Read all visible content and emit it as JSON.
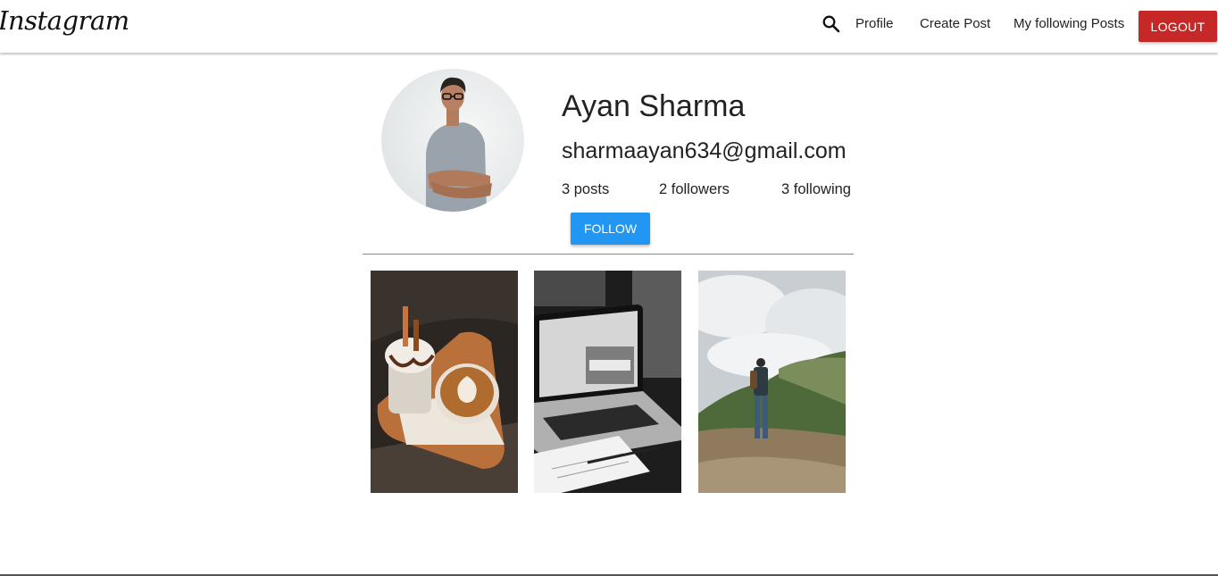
{
  "nav": {
    "brand": "Instagram",
    "search_icon": "search-icon",
    "links": [
      "Profile",
      "Create Post",
      "My following Posts"
    ],
    "logout_label": "LOGOUT"
  },
  "profile": {
    "name": "Ayan Sharma",
    "email": "sharmaayan634@gmail.com",
    "posts": "3 posts",
    "followers": "2 followers",
    "following": "3 following",
    "follow_label": "FOLLOW"
  },
  "posts": [
    {
      "subject": "coffee and ice cream"
    },
    {
      "subject": "laptop and notebook"
    },
    {
      "subject": "hiker on mountain"
    }
  ],
  "colors": {
    "logout": "#c62828",
    "follow": "#2196f3"
  }
}
